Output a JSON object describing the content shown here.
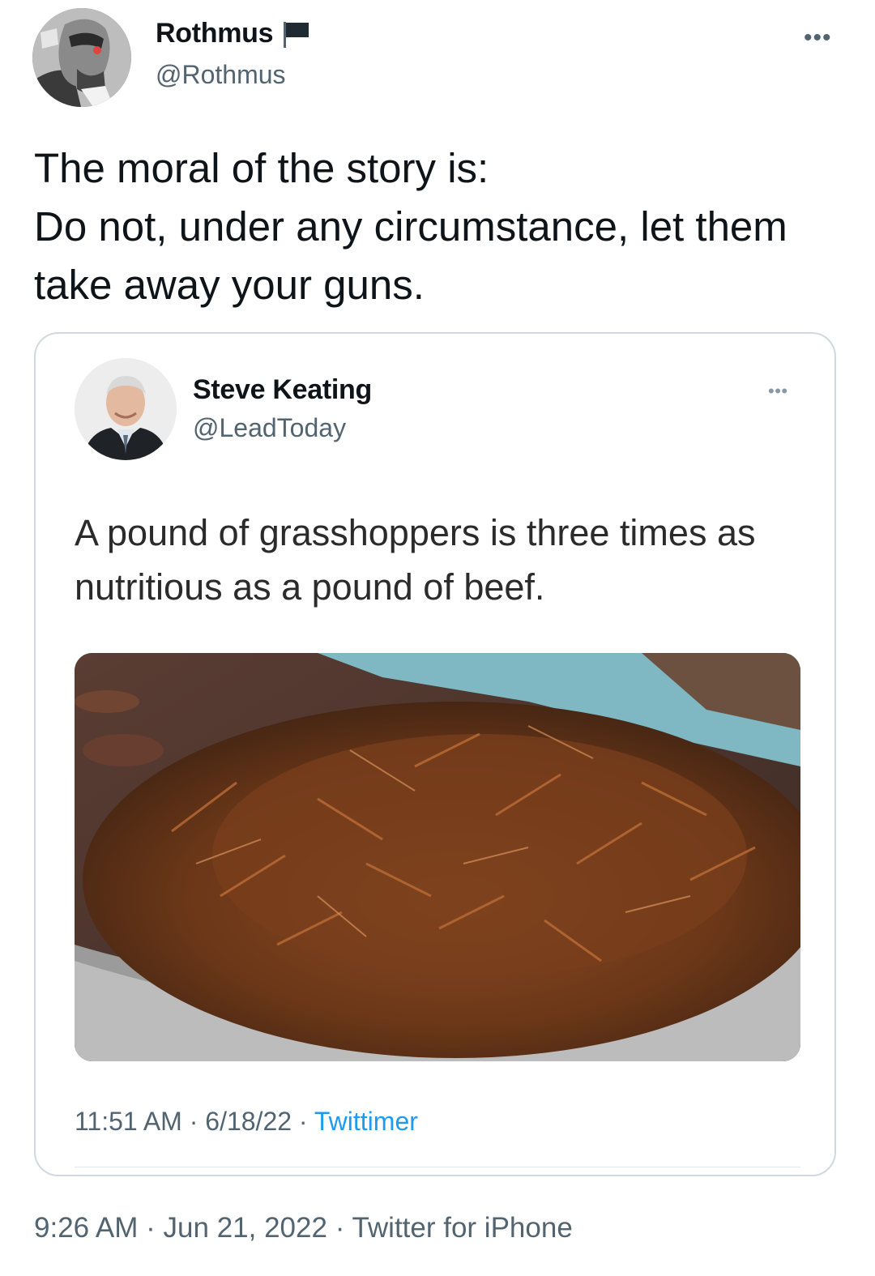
{
  "tweet": {
    "author_name": "Rothmus",
    "author_handle": "@Rothmus",
    "text": "The moral of the story is:\nDo not, under any circumstance, let them take away your guns.",
    "timestamp": "9:26 AM",
    "date": "Jun 21, 2022",
    "client": "Twitter for iPhone",
    "separator": "·"
  },
  "quoted": {
    "author_name": "Steve Keating",
    "author_handle": "@LeadToday",
    "text": "A pound of grasshoppers is three times as nutritious as a pound of beef.",
    "time": "11:51 AM",
    "date": "6/18/22",
    "source": "Twittimer",
    "separator": "·"
  },
  "icons": {
    "main_more": "more-horizontal-icon",
    "quote_more": "more-horizontal-icon",
    "badge": "flag-icon"
  },
  "more_glyph": "•••",
  "colors": {
    "text_primary": "#0f1419",
    "text_secondary": "#536471",
    "link": "#1d9bf0",
    "border": "#cfd9de"
  }
}
